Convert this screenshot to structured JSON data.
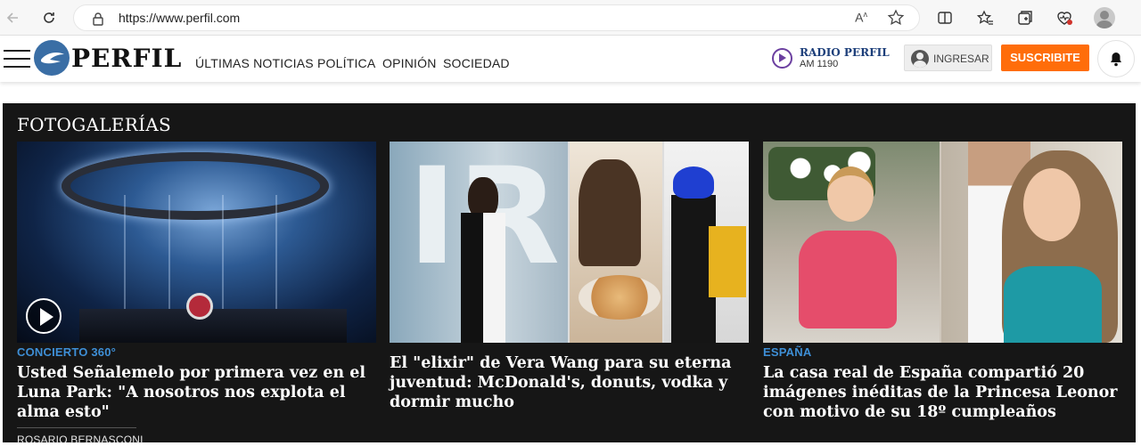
{
  "browser": {
    "url": "https://www.perfil.com",
    "reader_label": "A͡"
  },
  "header": {
    "logo_text": "PERFIL",
    "nav": [
      "ÚLTIMAS NOTICIAS",
      "POLÍTICA",
      "OPINIÓN",
      "SOCIEDAD"
    ],
    "radio_name": "RADIO PERFIL",
    "radio_freq": "AM 1190",
    "login_label": "INGRESAR",
    "subscribe_label": "SUSCRIBITE"
  },
  "colors": {
    "subscribe_bg": "#ff6d0a",
    "tag_color": "#3e8fd6",
    "gallery_bg": "#161616"
  },
  "gallery": {
    "title": "FOTOGALERÍAS",
    "cards": [
      {
        "tag": "CONCIERTO 360°",
        "headline": "Usted Señalemelo por primera vez en el Luna Park: \"A nosotros nos explota el alma esto\"",
        "author": "ROSARIO BERNASCONI",
        "has_video": true
      },
      {
        "tag": "",
        "headline": "El \"elixir\" de Vera Wang para su eterna juventud: McDonald's, donuts, vodka y dormir mucho",
        "author": ""
      },
      {
        "tag": "ESPAÑA",
        "headline": "La casa real de España compartió 20 imágenes inéditas de la Princesa Leonor con motivo de su 18º cumpleaños",
        "author": ""
      }
    ]
  }
}
